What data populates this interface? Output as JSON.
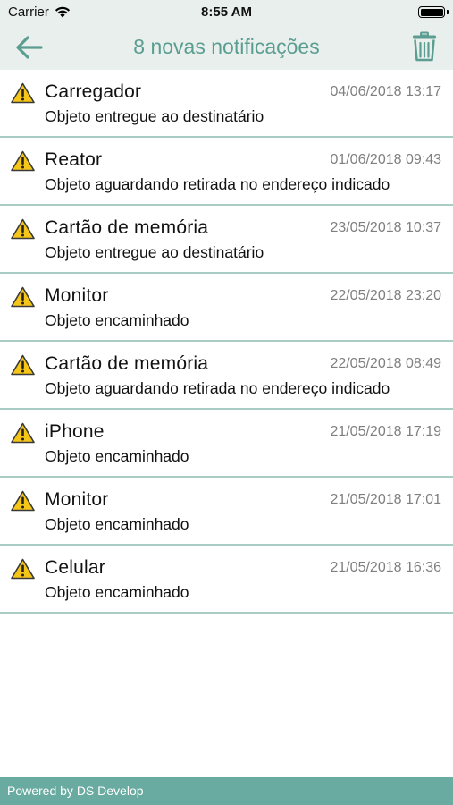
{
  "status_bar": {
    "carrier": "Carrier",
    "time": "8:55 AM"
  },
  "nav": {
    "title": "8 novas notificações",
    "back_icon": "arrow-left-icon",
    "trash_icon": "trash-icon"
  },
  "colors": {
    "accent": "#5b9e91",
    "header_bg": "#e9efed",
    "divider": "#a9ccc4",
    "footer_bg": "#69aba0",
    "warning_yellow": "#f5c518"
  },
  "notifications": [
    {
      "title": "Carregador",
      "date": "04/06/2018 13:17",
      "status": "Objeto entregue ao destinatário"
    },
    {
      "title": "Reator",
      "date": "01/06/2018 09:43",
      "status": "Objeto aguardando retirada no endereço indicado"
    },
    {
      "title": "Cartão de memória",
      "date": "23/05/2018 10:37",
      "status": "Objeto entregue ao destinatário"
    },
    {
      "title": "Monitor",
      "date": "22/05/2018 23:20",
      "status": "Objeto encaminhado"
    },
    {
      "title": "Cartão de memória",
      "date": "22/05/2018 08:49",
      "status": "Objeto aguardando retirada no endereço indicado"
    },
    {
      "title": "iPhone",
      "date": "21/05/2018 17:19",
      "status": "Objeto encaminhado"
    },
    {
      "title": "Monitor",
      "date": "21/05/2018 17:01",
      "status": "Objeto encaminhado"
    },
    {
      "title": "Celular",
      "date": "21/05/2018 16:36",
      "status": "Objeto encaminhado"
    }
  ],
  "footer": {
    "text": "Powered by DS Develop"
  }
}
